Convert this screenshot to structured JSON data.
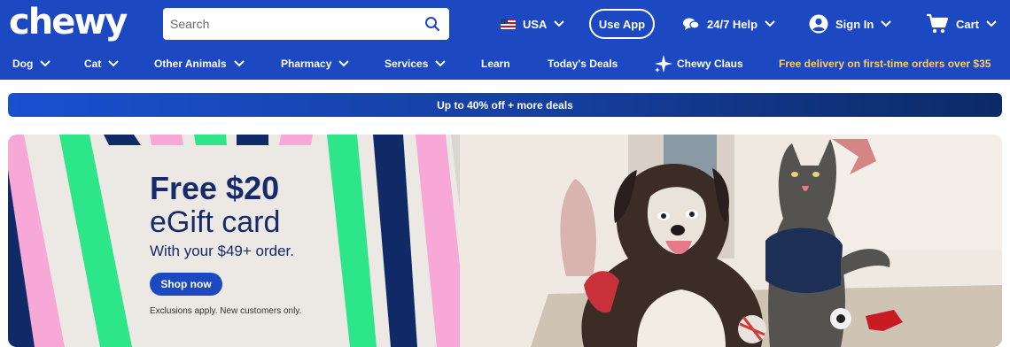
{
  "header": {
    "logo_text": "chewy",
    "search": {
      "placeholder": "Search"
    },
    "region": {
      "label": "USA",
      "icon": "us-flag-icon"
    },
    "use_app_label": "Use App",
    "help_label": "24/7 Help",
    "sign_in_label": "Sign In",
    "cart_label": "Cart"
  },
  "nav": {
    "items": [
      {
        "label": "Dog",
        "has_menu": true
      },
      {
        "label": "Cat",
        "has_menu": true
      },
      {
        "label": "Other Animals",
        "has_menu": true
      },
      {
        "label": "Pharmacy",
        "has_menu": true
      },
      {
        "label": "Services",
        "has_menu": true
      },
      {
        "label": "Learn",
        "has_menu": false
      },
      {
        "label": "Today's Deals",
        "has_menu": false
      },
      {
        "label": "Chewy Claus",
        "has_menu": false
      }
    ],
    "promo": "Free delivery on first-time orders over $35"
  },
  "deals_banner": {
    "text": "Up to 40% off + more deals"
  },
  "hero": {
    "title": "Free $20",
    "subtitle": "eGift card",
    "condition": "With your $49+ order.",
    "cta": "Shop now",
    "fine_print": "Exclusions apply. New customers only."
  },
  "colors": {
    "brand_blue": "#1c49c2",
    "navy": "#162a6c",
    "promo_yellow": "#ffce5c",
    "stripe_pink": "#f7a8d6",
    "stripe_green": "#2ee68a",
    "stripe_navy": "#0f2a66"
  }
}
